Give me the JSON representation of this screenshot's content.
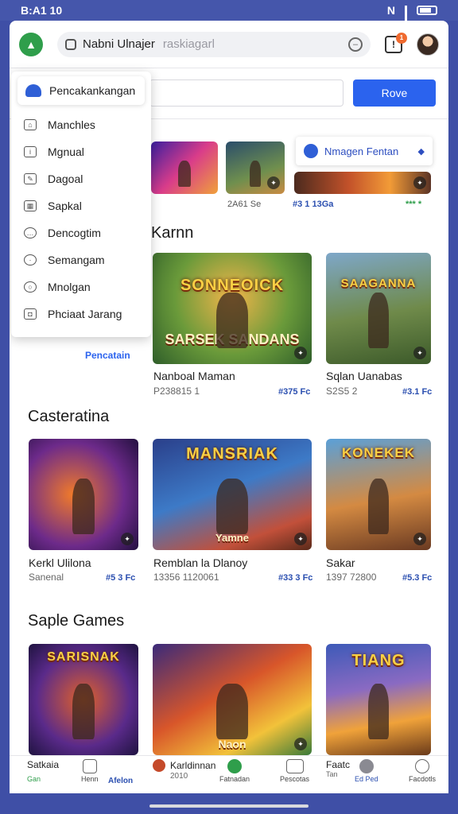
{
  "status_bar": {
    "time": "B:A1 10"
  },
  "topbar": {
    "search_query": "Nabni Ulnajer",
    "search_placeholder": "raskiagarl",
    "notification_count": "1"
  },
  "second_row": {
    "button_label": "Rove"
  },
  "dropdown": {
    "header": "Pencakankangan",
    "items": [
      {
        "label": "Manchles",
        "icon": "home-icon"
      },
      {
        "label": "Mgnual",
        "icon": "info-icon"
      },
      {
        "label": "Dagoal",
        "icon": "pencil-icon"
      },
      {
        "label": "Sapkal",
        "icon": "grid-icon"
      },
      {
        "label": "Dencogtim",
        "icon": "chat-icon"
      },
      {
        "label": "Semangam",
        "icon": "clock-icon"
      },
      {
        "label": "Mnolgan",
        "icon": "search-icon"
      },
      {
        "label": "Phciaat Jarang",
        "icon": "camera-icon"
      }
    ],
    "caption": "Pencatain"
  },
  "promo": {
    "label": "Nmagen Fentan"
  },
  "top_strip": {
    "meta_left": "2A61 Se",
    "meta_mid": "#3 1 13Ga",
    "meta_right": "*** *"
  },
  "sections": [
    {
      "title": "Karnn",
      "games": [
        {
          "name": "Nanboal Maman",
          "meta": "P238815 1",
          "price": "#375 Fc",
          "art_top": "SONNEOICK",
          "art_bottom": "SARSEK SANDANS"
        },
        {
          "name": "Sqlan Uanabas",
          "meta": "S2S5 2",
          "price": "#3.1 Fc",
          "art_top": "SAAGANNA",
          "art_bottom": ""
        }
      ]
    },
    {
      "title": "Casteratina",
      "games": [
        {
          "name": "Kerkl Ulilona",
          "meta": "Sanenal",
          "price": "#5 3 Fc",
          "art_top": "",
          "art_bottom": ""
        },
        {
          "name": "Remblan la Dlanoy",
          "meta": "13356 1120061",
          "price": "#33 3 Fc",
          "art_top": "MANSRIAK",
          "art_bottom": "Yamne"
        },
        {
          "name": "Sakar",
          "meta": "1397 72800",
          "price": "#5.3 Fc",
          "art_top": "KONEKEK",
          "art_bottom": ""
        }
      ]
    },
    {
      "title": "Saple Games",
      "games": [
        {
          "name": "",
          "meta": "",
          "price": "",
          "art_top": "SARISNAK",
          "art_bottom": ""
        },
        {
          "name": "",
          "meta": "",
          "price": "",
          "art_top": "",
          "art_bottom": "Naon"
        },
        {
          "name": "",
          "meta": "",
          "price": "",
          "art_top": "TIANG",
          "art_bottom": ""
        }
      ]
    }
  ],
  "bottom_nav": {
    "left_title": "Satkaia",
    "left_sub": "Gan",
    "items": [
      {
        "label": "Henn",
        "icon": "phone-icon"
      },
      {
        "label": "Afelon",
        "icon": ""
      },
      {
        "label": "Fatnadan",
        "icon": "chat-icon"
      },
      {
        "label": "Pescotas",
        "icon": "message-icon"
      },
      {
        "label": "Facdotls",
        "icon": "person-icon"
      }
    ],
    "center_title": "Karldinnan",
    "center_sub": "2010",
    "right_title": "Faatc",
    "right_sub": "Tan",
    "right_mid": "Ed Ped"
  },
  "colors": {
    "accent": "#2b63ee",
    "status_bar": "#4556ab",
    "price_blue": "#2b4fb0",
    "green": "#2f9e4b"
  }
}
